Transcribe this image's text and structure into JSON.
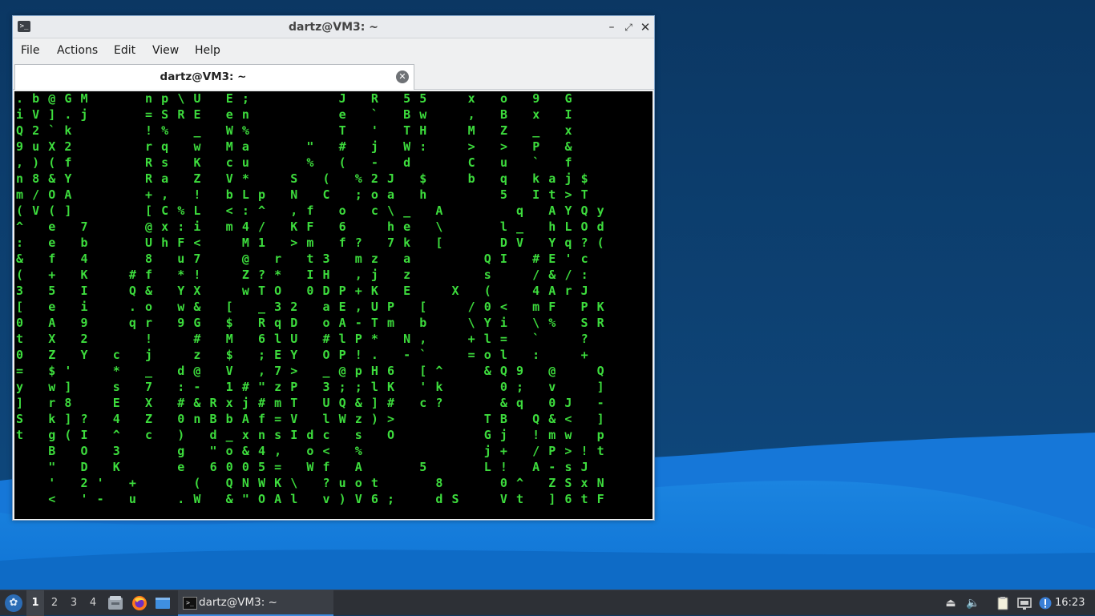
{
  "window": {
    "title": "dartz@VM3: ~",
    "app_icon": "terminal-icon",
    "controls": {
      "minimize": "minimize-icon",
      "maximize": "maximize-icon",
      "close": "close-icon"
    }
  },
  "menubar": {
    "items": [
      "File",
      "Actions",
      "Edit",
      "View",
      "Help"
    ]
  },
  "tabs": [
    {
      "label": "dartz@VM3: ~",
      "close_icon": "close-tab-icon"
    }
  ],
  "terminal": {
    "fg_color": "#3ddc3d",
    "head_color": "#ffffff",
    "bg_color": "#000000",
    "lines": [
      ". b @ G M       n p \\ U   E ;           J   R   5 5     x   o   9   G",
      "i V ] . j       = S R E   e n           e   `   B w     ,   B   x   I",
      "Q 2 ` k         ! %   _   W %           T   '   T H     M   Z   _   x",
      "9 u X 2         r q   w   M a       \"   #   j   W :     >   >   P   &",
      ", ) ( f         R s   K   c u       %   (   -   d       C   u   `   f",
      "n 8 & Y         R a   Z   V *     S   (   % 2 J   $     b   q   k a j $",
      "m / O A         + ,   !   b L p   N   C   ; o a   h         5   I t > T",
      "( V ( ]         [ C % L   < : ^   , f   o   c \\ _   A         q   A Y Q y",
      "^   e   7       @ x : i   m 4 /   K F   6     h e   \\       l _   h L O d",
      ":   e   b       U h F <     M 1   > m   f ?   7 k   [       D V   Y q ? (",
      "&   f   4       8   u 7     @   r   t 3   m z   a         Q I   # E ' c",
      "(   +   K     # f   * !     Z ? *   I H   , j   z         s     / & / :",
      "3   5   I     Q &   Y X     w T O   0 D P + K   E     X   (     4 A r J",
      "[   e   i     . o   w &   [   _ 3 2   a E , U P   [     / 0 <   m F   P K",
      "0   A   9     q r   9 G   $   R q D   o A - T m   b     \\ Y i   \\ %   S R",
      "t   X   2       !     #   M   6 l U   # l P *   N ,     + l =   `     ?",
      "0   Z   Y   c   j     z   $   ; E Y   O P ! .   - `     = o l   :     +",
      "=   $ '     *   _   d @   V   , 7 >   _ @ p H 6   [ ^     & Q 9   @     Q",
      "y   w ]     s   7   : -   1 # \" z P   3 ; ; l K   ' k       0 ;   v     ]",
      "]   r 8     E   X   # & R x j # m T   U Q & ] #   c ?       & q   0 J   -",
      "S   k ] ?   4   Z   0 n B b A f = V   l W z ) >           T B   Q & <   ]",
      "t   g ( I   ^   c   )   d _ x n s I d c   s   O           G j   ! m w   p",
      "    B   O   3       g   \" o & 4 ,   o <   %               j +   / P > ! t",
      "    \"   D   K       e   6 0 0 5 =   W f   A       5       L !   A - s J",
      "    '   2 '   +       (   Q N W K \\   ? u o t       8       0 ^   Z S x N",
      "    <   ' -   u     . W   & \" O A l   v ) V 6 ;     d S     V t   ] 6 t F"
    ]
  },
  "taskbar": {
    "start_icon": "lubuntu-menu-icon",
    "workspaces": [
      "1",
      "2",
      "3",
      "4"
    ],
    "active_workspace": "1",
    "launchers": [
      "file-manager-icon",
      "firefox-icon",
      "show-desktop-icon"
    ],
    "task": {
      "label": "dartz@VM3: ~",
      "icon": "terminal-icon"
    },
    "tray": [
      "eject-icon",
      "volume-icon",
      "clipboard-icon",
      "network-icon",
      "update-notifier-icon"
    ],
    "clock": "16:23"
  }
}
